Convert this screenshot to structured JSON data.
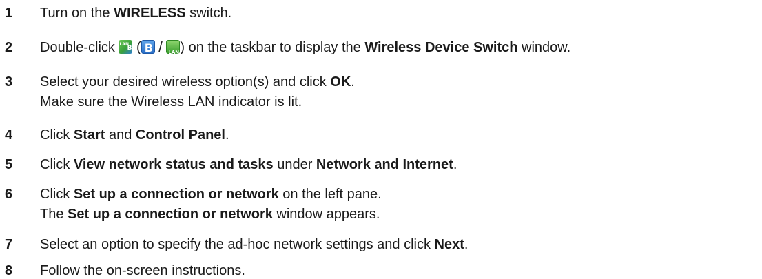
{
  "steps": [
    {
      "num": "1",
      "text": [
        "Turn on the ",
        "WIRELESS",
        " switch."
      ]
    },
    {
      "num": "2",
      "pre": "Double-click ",
      "paren_open": " (",
      "slash": " / ",
      "post": ") on the taskbar to display the ",
      "bold": "Wireless Device Switch",
      "end": " window.",
      "icons": [
        "wireless-lan-bluetooth-icon",
        "bluetooth-icon",
        "wireless-lan-icon"
      ]
    },
    {
      "num": "3",
      "line1": [
        "Select your desired wireless option(s) and click ",
        "OK",
        "."
      ],
      "line2": "Make sure the Wireless LAN indicator is lit."
    },
    {
      "num": "4",
      "text": [
        "Click ",
        "Start",
        " and ",
        "Control Panel",
        "."
      ]
    },
    {
      "num": "5",
      "text": [
        "Click ",
        "View network status and tasks",
        " under ",
        "Network and Internet",
        "."
      ]
    },
    {
      "num": "6",
      "line1": [
        "Click ",
        "Set up a connection or network",
        " on the left pane."
      ],
      "line2": [
        "The ",
        "Set up a connection or network",
        " window appears."
      ]
    },
    {
      "num": "7",
      "text": [
        "Select an option to specify the ad-hoc network settings and click ",
        "Next",
        "."
      ]
    },
    {
      "num": "8",
      "text": "Follow the on-screen instructions."
    }
  ],
  "icon_colors": {
    "bluetooth": "#2a6fc7",
    "lan": "#3b9f2e"
  }
}
